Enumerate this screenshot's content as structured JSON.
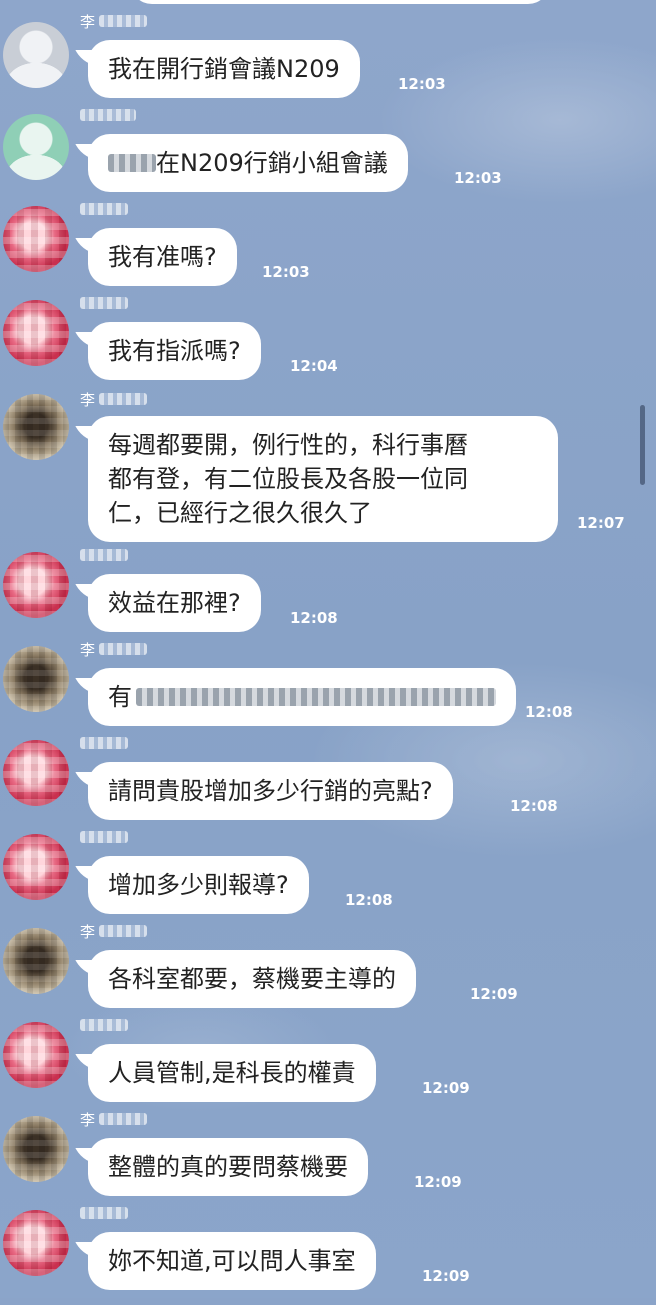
{
  "conversation": {
    "messages": [
      {
        "sender": "李",
        "text": "我在開行銷會議N209",
        "time": "12:03"
      },
      {
        "sender": "",
        "text_suffix": "在N209行銷小組會議",
        "time": "12:03"
      },
      {
        "sender": "",
        "text": "我有准嗎?",
        "time": "12:03"
      },
      {
        "sender": "",
        "text": "我有指派嗎?",
        "time": "12:04"
      },
      {
        "sender": "李",
        "lines": [
          "每週都要開，例行性的，科行事曆",
          "都有登，有二位股長及各股一位同",
          "仁，已經行之很久很久了"
        ],
        "time": "12:07"
      },
      {
        "sender": "",
        "text": "效益在那裡?",
        "time": "12:08"
      },
      {
        "sender": "李",
        "text_prefix": "有",
        "time": "12:08"
      },
      {
        "sender": "",
        "text": "請問貴股增加多少行銷的亮點?",
        "time": "12:08"
      },
      {
        "sender": "",
        "text": "增加多少則報導?",
        "time": "12:08"
      },
      {
        "sender": "李",
        "text": "各科室都要，蔡機要主導的",
        "time": "12:09"
      },
      {
        "sender": "",
        "text": "人員管制,是科長的權責",
        "time": "12:09"
      },
      {
        "sender": "李",
        "text": "整體的真的要問蔡機要",
        "time": "12:09"
      },
      {
        "sender": "",
        "text": "妳不知道,可以問人事室",
        "time": "12:09"
      }
    ]
  },
  "colors": {
    "background": "#8aa3c8",
    "bubble": "#ffffff",
    "timestamp": "#ffffff"
  }
}
